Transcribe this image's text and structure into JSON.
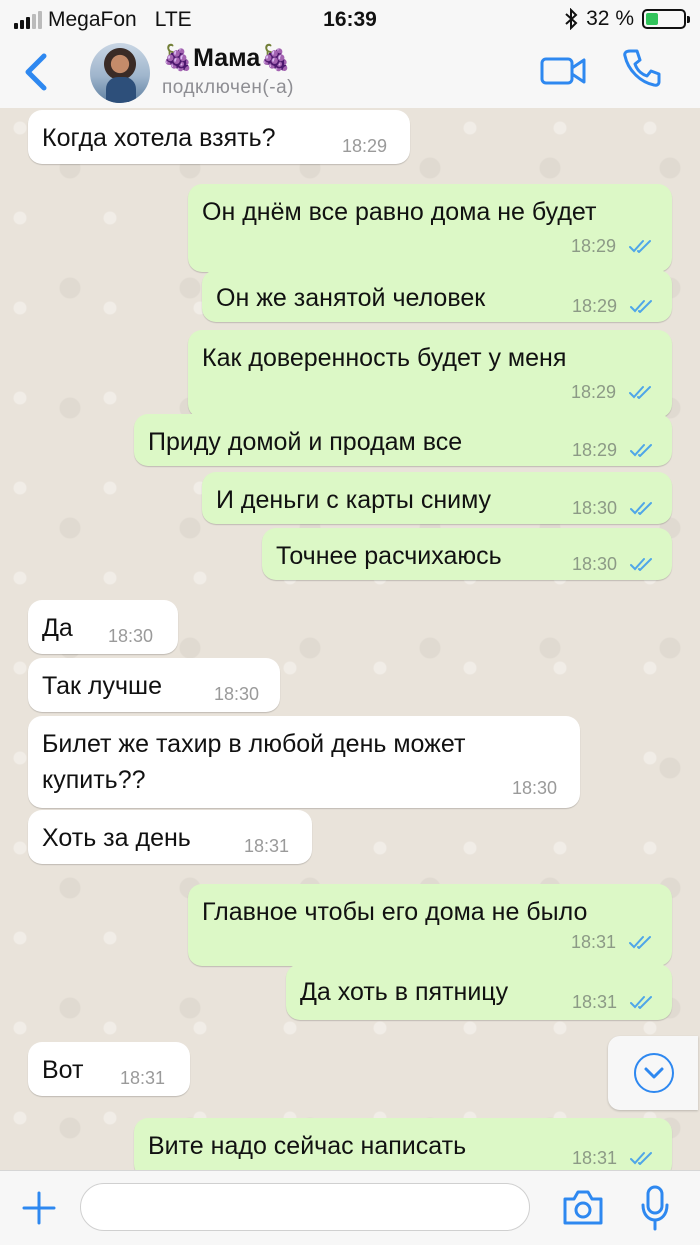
{
  "status_bar": {
    "carrier": "MegaFon",
    "network": "LTE",
    "time": "16:39",
    "battery": "32 %",
    "battery_level": 0.32,
    "bluetooth_icon": "bluetooth-icon"
  },
  "header": {
    "back_icon": "chevron-left-icon",
    "contact_name": "🍇Мама🍇",
    "contact_status": "подключен(-а)",
    "video_icon": "video-camera-icon",
    "call_icon": "phone-icon"
  },
  "messages": [
    {
      "dir": "in",
      "text": "Когда хотела взять?",
      "time": "18:29"
    },
    {
      "dir": "out",
      "text": "Он днём все равно дома не будет",
      "time": "18:29"
    },
    {
      "dir": "out",
      "text": "Он же занятой человек",
      "time": "18:29"
    },
    {
      "dir": "out",
      "text": "Как доверенность будет у меня",
      "time": "18:29"
    },
    {
      "dir": "out",
      "text": "Приду домой и продам все",
      "time": "18:29"
    },
    {
      "dir": "out",
      "text": "И деньги с карты сниму",
      "time": "18:30"
    },
    {
      "dir": "out",
      "text": "Точнее расчихаюсь",
      "time": "18:30"
    },
    {
      "dir": "in",
      "text": "Да",
      "time": "18:30"
    },
    {
      "dir": "in",
      "text": "Так лучше",
      "time": "18:30"
    },
    {
      "dir": "in",
      "text": "Билет же тахир в любой день может\nкупить??",
      "time": "18:30"
    },
    {
      "dir": "in",
      "text": "Хоть за день",
      "time": "18:31"
    },
    {
      "dir": "out",
      "text": "Главное чтобы его дома не было",
      "time": "18:31"
    },
    {
      "dir": "out",
      "text": "Да хоть в пятницу",
      "time": "18:31"
    },
    {
      "dir": "in",
      "text": "Вот",
      "time": "18:31"
    },
    {
      "dir": "out",
      "text": "Вите надо сейчас написать",
      "time": "18:31"
    }
  ],
  "colors": {
    "accent": "#2e88f0",
    "outgoing_bubble": "#dcf8c6",
    "incoming_bubble": "#ffffff",
    "read_ticks": "#4fa6e8"
  },
  "input_bar": {
    "plus_icon": "plus-icon",
    "message_value": "",
    "camera_icon": "camera-icon",
    "mic_icon": "microphone-icon"
  },
  "scroll_down_icon": "chevron-down-circle-icon"
}
